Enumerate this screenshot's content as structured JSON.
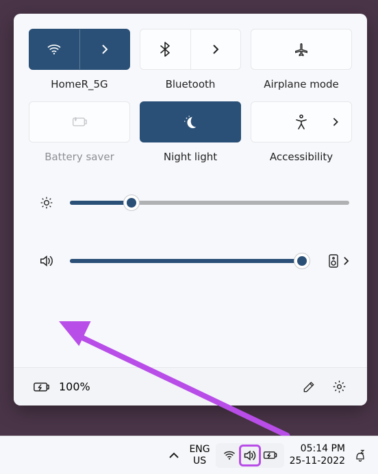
{
  "tiles": {
    "row1": [
      {
        "name": "wifi",
        "label": "HomeR_5G",
        "on": true,
        "split": true,
        "icon": "wifi"
      },
      {
        "name": "bluetooth",
        "label": "Bluetooth",
        "on": false,
        "split": true,
        "icon": "bluetooth"
      },
      {
        "name": "airplane",
        "label": "Airplane mode",
        "on": false,
        "split": false,
        "icon": "airplane"
      }
    ],
    "row2": [
      {
        "name": "battery-saver",
        "label": "Battery saver",
        "on": false,
        "disabled": true,
        "split": false,
        "icon": "battery-saver"
      },
      {
        "name": "night-light",
        "label": "Night light",
        "on": true,
        "split": false,
        "icon": "night-light"
      },
      {
        "name": "accessibility",
        "label": "Accessibility",
        "on": false,
        "split": false,
        "chevron": true,
        "icon": "accessibility"
      }
    ]
  },
  "sliders": {
    "brightness": {
      "value_pct": 22
    },
    "volume": {
      "value_pct": 97
    }
  },
  "footer": {
    "battery_pct": "100%"
  },
  "taskbar": {
    "lang_top": "ENG",
    "lang_bottom": "US",
    "time": "05:14 PM",
    "date": "25-11-2022"
  },
  "annotation": {
    "arrow_color": "#b84de8"
  }
}
